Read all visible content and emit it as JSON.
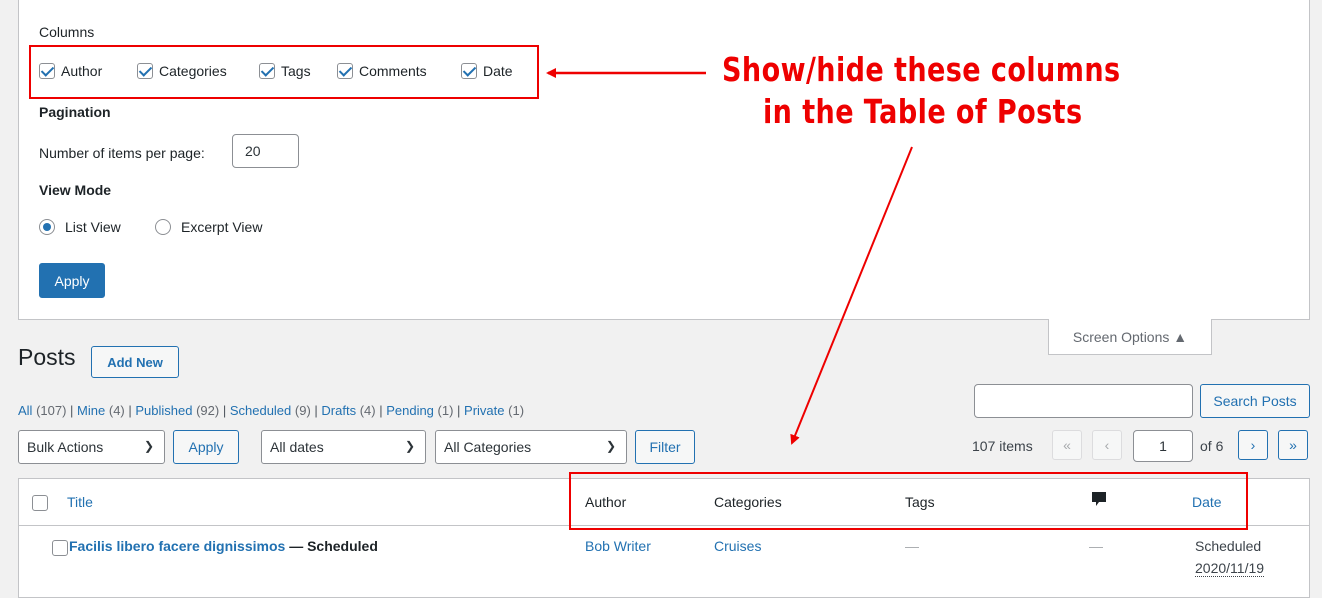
{
  "screen_options": {
    "columns_heading": "Columns",
    "columns": [
      {
        "label": "Author",
        "checked": true
      },
      {
        "label": "Categories",
        "checked": true
      },
      {
        "label": "Tags",
        "checked": true
      },
      {
        "label": "Comments",
        "checked": true
      },
      {
        "label": "Date",
        "checked": true
      }
    ],
    "pagination_heading": "Pagination",
    "items_per_page_label": "Number of items per page:",
    "items_per_page_value": "20",
    "view_mode_heading": "View Mode",
    "view_modes": [
      {
        "label": "List View",
        "selected": true
      },
      {
        "label": "Excerpt View",
        "selected": false
      }
    ],
    "apply_label": "Apply",
    "tab_label": "Screen Options ▲"
  },
  "annotation": {
    "line1": "Show/hide these columns",
    "line2": "in the Table of Posts",
    "color": "#e00000"
  },
  "header": {
    "title": "Posts",
    "add_new_label": "Add New"
  },
  "status_links": [
    {
      "label": "All",
      "count": "(107)"
    },
    {
      "label": "Mine",
      "count": "(4)"
    },
    {
      "label": "Published",
      "count": "(92)"
    },
    {
      "label": "Scheduled",
      "count": "(9)"
    },
    {
      "label": "Drafts",
      "count": "(4)"
    },
    {
      "label": "Pending",
      "count": "(1)"
    },
    {
      "label": "Private",
      "count": "(1)"
    }
  ],
  "search": {
    "value": "",
    "button_label": "Search Posts"
  },
  "filters": {
    "bulk_actions": "Bulk Actions",
    "apply_label": "Apply",
    "dates": "All dates",
    "categories": "All Categories",
    "filter_label": "Filter"
  },
  "pagination": {
    "items_text": "107 items",
    "first": "«",
    "prev": "‹",
    "current_page": "1",
    "of_text": "of 6",
    "next": "›",
    "last": "»"
  },
  "table": {
    "headers": {
      "title": "Title",
      "author": "Author",
      "categories": "Categories",
      "tags": "Tags",
      "date": "Date"
    },
    "rows": [
      {
        "title": "Facilis libero facere dignissimos",
        "state": " — Scheduled",
        "author": "Bob Writer",
        "categories": "Cruises",
        "tags": "—",
        "comments": "—",
        "date_status": "Scheduled",
        "date_value": "2020/11/19"
      }
    ]
  },
  "colors": {
    "accent": "#2271b1",
    "annotation_red": "#e00000"
  }
}
